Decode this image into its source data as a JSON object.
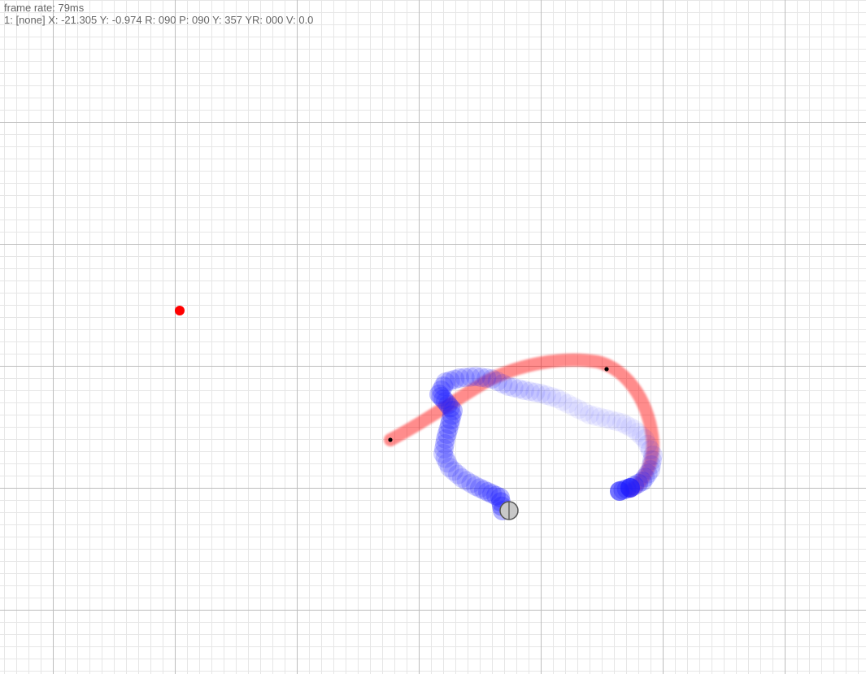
{
  "hud": {
    "frame_rate": "frame rate: 79ms",
    "status": "1: [none] X: -21.305 Y: -0.974 R: 090 P: 090 Y: 357 YR: 000 V: 0.0"
  },
  "colors": {
    "background": "#ffffff",
    "minor_grid": "#e6e6e6",
    "major_grid": "#bdbdbd",
    "red_trail": "#ff0000",
    "blue_trail": "#1a1aff",
    "robot_fill": "#c8c8c8",
    "robot_stroke": "#555555",
    "marker": "#000000",
    "hud_text": "#666666"
  },
  "icons": {
    "robot": "circle-with-crosshair-icon",
    "target": "red-dot-icon"
  }
}
